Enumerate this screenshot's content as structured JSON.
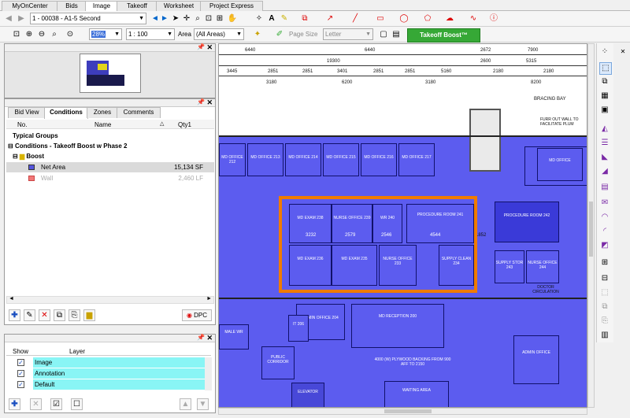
{
  "tabs": [
    {
      "label": "MyOnCenter"
    },
    {
      "label": "Bids"
    },
    {
      "label": "Image"
    },
    {
      "label": "Takeoff"
    },
    {
      "label": "Worksheet"
    },
    {
      "label": "Project Express"
    }
  ],
  "toolbar1": {
    "page_select": "1 - 00038 - A1-5 Second"
  },
  "toolbar2": {
    "zoom": "28%",
    "scale": "1 : 100",
    "area_label": "Area",
    "area_select": "(All Areas)",
    "page_size_label": "Page Size",
    "page_size_select": "Letter",
    "boost_button": "Takeoff Boost™"
  },
  "tabs_panel": [
    {
      "label": "Bid View"
    },
    {
      "label": "Conditions"
    },
    {
      "label": "Zones"
    },
    {
      "label": "Comments"
    }
  ],
  "conditions": {
    "headers": {
      "no": "No.",
      "name": "Name",
      "qty1": "Qty1"
    },
    "typical_groups": "Typical Groups",
    "group_title": "Conditions - Takeoff Boost w Phase 2",
    "folder": "Boost",
    "items": [
      {
        "name": "Net Area",
        "qty": "15,134 SF",
        "color": "#5555dd"
      },
      {
        "name": "Wall",
        "qty": "2,460 LF",
        "color": "#f07878"
      }
    ],
    "dpc_label": "DPC"
  },
  "layers": {
    "headers": {
      "show": "Show",
      "layer": "Layer"
    },
    "items": [
      {
        "name": "Image"
      },
      {
        "name": "Annotation"
      },
      {
        "name": "Default"
      }
    ]
  },
  "drawing": {
    "dims_top": [
      "6440",
      "6440",
      "2672",
      "7900"
    ],
    "dims_mid": [
      "19300",
      "2600",
      "5315"
    ],
    "dims_low": [
      "3445",
      "2851",
      "2851",
      "3401",
      "2851",
      "2851",
      "5160",
      "2180",
      "2180"
    ],
    "dims_low2": [
      "3180",
      "6200",
      "3180",
      "8200"
    ],
    "bracing": "BRACING BAY",
    "furr_note": "FURR OUT WALL TO FACILITATE PLUM",
    "rooms": [
      {
        "label": "MD OFFICE 213"
      },
      {
        "label": "MD OFFICE 214"
      },
      {
        "label": "MD OFFICE 215"
      },
      {
        "label": "MD OFFICE 216"
      },
      {
        "label": "MD OFFICE 217"
      },
      {
        "label": "MD EXAM 238"
      },
      {
        "label": "NURSE OFFICE 239"
      },
      {
        "label": "WR 240"
      },
      {
        "label": "PROCEDURE ROOM 241"
      },
      {
        "label": "MD EXAM 236"
      },
      {
        "label": "MD EXAM 235"
      },
      {
        "label": "NURSE OFFICE 233"
      },
      {
        "label": "SUPPLY CLEAN 234"
      },
      {
        "label": "PROCEDURE ROOM 242"
      },
      {
        "label": "SUPPLY STOR 243"
      },
      {
        "label": "NURSE OFFICE 244"
      },
      {
        "label": "DOCTOR CIRCULATION"
      },
      {
        "label": "ADMIN OFFICE 204"
      },
      {
        "label": "MD RECEPTION 200"
      },
      {
        "label": "ADMIN OFFICE"
      },
      {
        "label": "MALE WR"
      },
      {
        "label": "PUBLIC CORRIDOR"
      },
      {
        "label": "WAITING AREA"
      },
      {
        "label": "ELEVATOR"
      },
      {
        "label": "IT 206"
      },
      {
        "label": "MD OFFICE 212"
      },
      {
        "label": "MD OFFICE"
      }
    ],
    "plywood_note": "4000 (W) PLYWOOD BACKING FROM 900 AFF TO 2150",
    "dim_1852": "1852",
    "dim_4544": "4544",
    "dim_3232": "3232",
    "dim_2579": "2579",
    "dim_2546": "2546"
  },
  "colors": {
    "room_fill": "#5c5cef",
    "highlight": "#f07b00",
    "boost_green": "#36a836"
  }
}
